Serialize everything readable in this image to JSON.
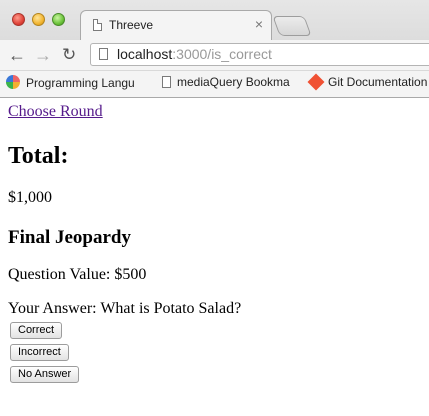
{
  "browser": {
    "tab_title": "Threeve",
    "url_host": "localhost",
    "url_rest": ":3000/is_correct",
    "bookmarks": [
      {
        "label": "Programming Langu",
        "fade": "a"
      },
      {
        "label": "mediaQuery Bookma",
        "fade": ""
      },
      {
        "label": "Git Documentation",
        "fade": ""
      }
    ]
  },
  "page": {
    "choose_round_link": "Choose Round",
    "total_heading": "Total:",
    "total_value": "$1,000",
    "round_heading": "Final Jeopardy",
    "question_value": "Question Value: $500",
    "your_answer": "Your Answer: What is Potato Salad?",
    "buttons": {
      "correct": "Correct",
      "incorrect": "Incorrect",
      "no_answer": "No Answer"
    }
  }
}
